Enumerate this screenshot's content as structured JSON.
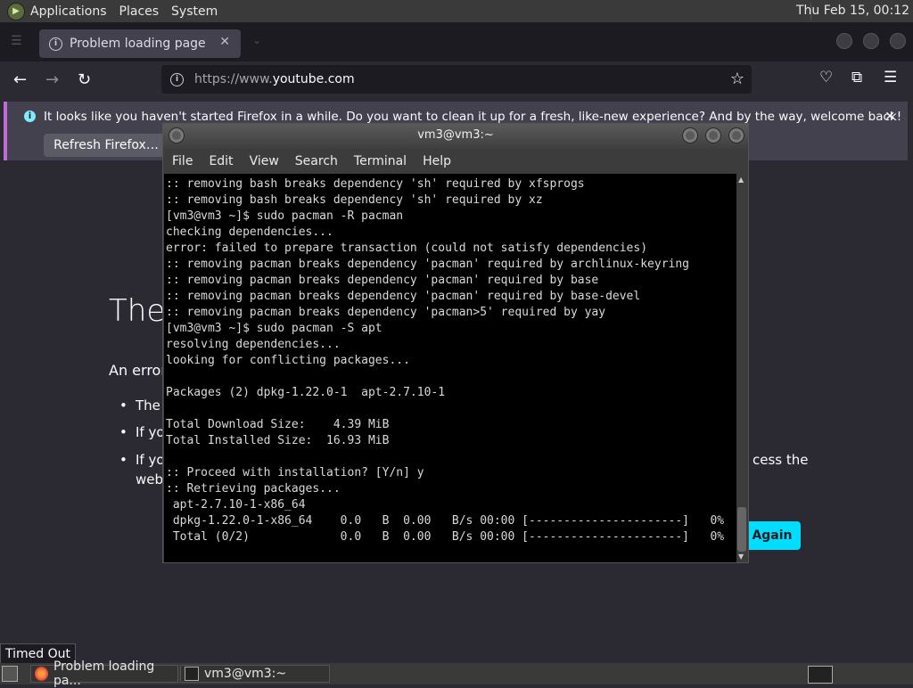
{
  "top_panel": {
    "menus": [
      "Applications",
      "Places",
      "System"
    ],
    "clock": "Thu Feb 15, 00:12"
  },
  "firefox": {
    "tab_title": "Problem loading page",
    "url_prefix": "https://www.",
    "url_domain": "youtube.com",
    "notification": {
      "message": "It looks like you haven't started Firefox in a while. Do you want to clean it up for a fresh, like-new experience? And by the way, welcome back!",
      "button": "Refresh Firefox…"
    },
    "error_page": {
      "title_visible": "The",
      "intro_visible": "An error",
      "bullets": [
        "The",
        "If you",
        "If you"
      ],
      "bullet_tail": "web",
      "right_fragment": "cess the",
      "try_again_visible": "Again"
    }
  },
  "terminal": {
    "title": "vm3@vm3:~",
    "menus": [
      "File",
      "Edit",
      "View",
      "Search",
      "Terminal",
      "Help"
    ],
    "lines": [
      ":: removing bash breaks dependency 'sh' required by xfsprogs",
      ":: removing bash breaks dependency 'sh' required by xz",
      "[vm3@vm3 ~]$ sudo pacman -R pacman",
      "checking dependencies...",
      "error: failed to prepare transaction (could not satisfy dependencies)",
      ":: removing pacman breaks dependency 'pacman' required by archlinux-keyring",
      ":: removing pacman breaks dependency 'pacman' required by base",
      ":: removing pacman breaks dependency 'pacman' required by base-devel",
      ":: removing pacman breaks dependency 'pacman>5' required by yay",
      "[vm3@vm3 ~]$ sudo pacman -S apt",
      "resolving dependencies...",
      "looking for conflicting packages...",
      "",
      "Packages (2) dpkg-1.22.0-1  apt-2.7.10-1",
      "",
      "Total Download Size:    4.39 MiB",
      "Total Installed Size:  16.93 MiB",
      "",
      ":: Proceed with installation? [Y/n] y",
      ":: Retrieving packages...",
      " apt-2.7.10-1-x86_64",
      " dpkg-1.22.0-1-x86_64    0.0   B  0.00   B/s 00:00 [----------------------]   0%",
      " Total (0/2)             0.0   B  0.00   B/s 00:00 [----------------------]   0%"
    ]
  },
  "status_tip": "Timed Out",
  "taskbar": {
    "items": [
      "Problem loading pa...",
      "vm3@vm3:~"
    ]
  },
  "colors": {
    "accent": "#00ddff",
    "notification_stripe": "#c06bd6"
  }
}
